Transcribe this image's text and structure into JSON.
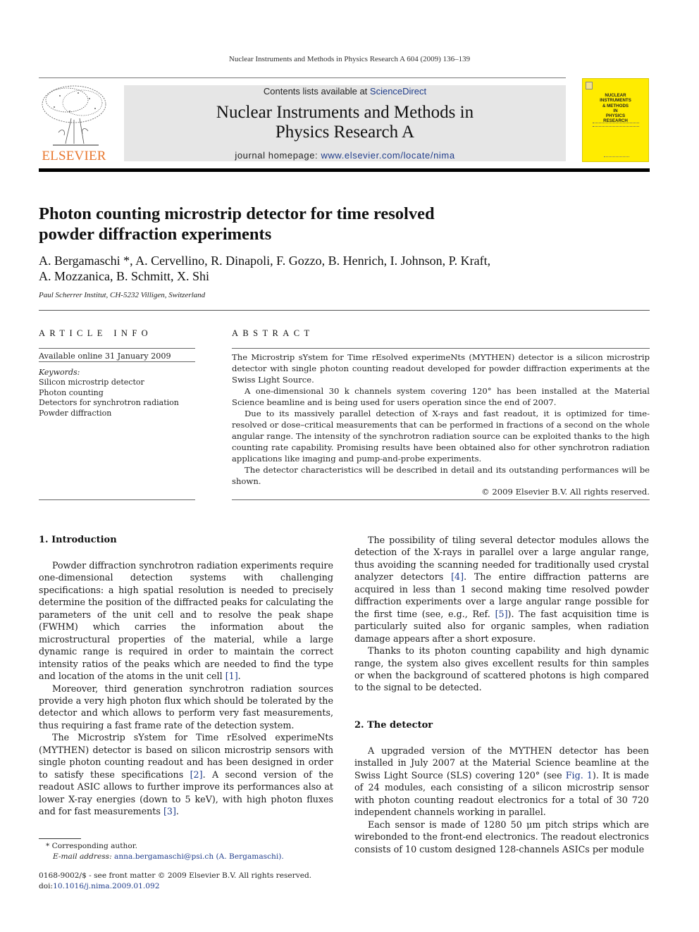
{
  "running_head": "Nuclear Instruments and Methods in Physics Research A 604 (2009) 136–139",
  "masthead": {
    "publisher_logo_text": "ELSEVIER",
    "contents_prefix": "Contents lists available at ",
    "contents_link": "ScienceDirect",
    "journal_title_line1": "Nuclear Instruments and Methods in",
    "journal_title_line2": "Physics Research A",
    "homepage_prefix": "journal homepage: ",
    "homepage_link": "www.elsevier.com/locate/nima",
    "cover_title": [
      "NUCLEAR",
      "INSTRUMENTS",
      "& METHODS",
      "IN",
      "PHYSICS",
      "RESEARCH"
    ],
    "colors": {
      "publisher_orange": "#e8772e",
      "cover_yellow": "#ffec00",
      "link_blue": "#1f3c8a",
      "masthead_gray": "#e6e6e6"
    }
  },
  "article": {
    "title_line1": "Photon counting microstrip detector for time resolved",
    "title_line2": "powder diffraction experiments",
    "authors_line1": "A. Bergamaschi *, A. Cervellino, R. Dinapoli, F. Gozzo, B. Henrich, I. Johnson, P. Kraft,",
    "authors_line2": "A. Mozzanica, B. Schmitt, X. Shi",
    "affiliation": "Paul Scherrer Institut, CH-5232 Villigen, Switzerland"
  },
  "article_info": {
    "heading": "ARTICLE INFO",
    "available_online": "Available online 31 January 2009",
    "keywords_label": "Keywords:",
    "keywords": [
      "Silicon microstrip detector",
      "Photon counting",
      "Detectors for synchrotron radiation",
      "Powder diffraction"
    ]
  },
  "abstract": {
    "heading": "ABSTRACT",
    "paragraphs": [
      "The Microstrip sYstem for Time rEsolved experimeNts (MYTHEN) detector is a silicon microstrip detector with single photon counting readout developed for powder diffraction experiments at the Swiss Light Source.",
      "A one-dimensional 30 k channels system covering 120° has been installed at the Material Science beamline and is being used for users operation since the end of 2007.",
      "Due to its massively parallel detection of X-rays and fast readout, it is optimized for time-resolved or dose–critical measurements that can be performed in fractions of a second on the whole angular range. The intensity of the synchrotron radiation source can be exploited thanks to the high counting rate capability. Promising results have been obtained also for other synchrotron radiation applications like imaging and pump-and-probe experiments.",
      "The detector characteristics will be described in detail and its outstanding performances will be shown."
    ],
    "copyright": "© 2009 Elsevier B.V. All rights reserved."
  },
  "body": {
    "section1_heading": "1.  Introduction",
    "s1_p1_text": "Powder diffraction synchrotron radiation experiments require one-dimensional detection systems with challenging specifications: a high spatial resolution is needed to precisely determine the position of the diffracted peaks for calculating the parameters of the unit cell and to resolve the peak shape (FWHM) which carries the information about the microstructural properties of the material, while a large dynamic range is required in order to maintain the correct intensity ratios of the peaks which are needed to find the type and location of the atoms in the unit cell ",
    "s1_p1_ref": "[1]",
    "s1_p2_text": "Moreover, third generation synchrotron radiation sources provide a very high photon flux which should be tolerated by the detector and which allows to perform very fast measurements, thus requiring a fast frame rate of the detection system.",
    "s1_p3_a": "The Microstrip sYstem for Time rEsolved experimeNts (MYTHEN) detector is based on silicon microstrip sensors with single photon counting readout and has been designed in order to satisfy these specifications ",
    "s1_p3_ref1": "[2]",
    "s1_p3_b": ". A second version of the readout ASIC allows to further improve its performances also at lower X-ray energies (down to 5 keV), with high photon fluxes and for fast measurements ",
    "s1_p3_ref2": "[3]",
    "s1_p4_a": "The possibility of tiling several detector modules allows the detection of the X-rays in parallel over a large angular range, thus avoiding the scanning needed for traditionally used crystal analyzer detectors ",
    "s1_p4_ref1": "[4]",
    "s1_p4_b": ". The entire diffraction patterns are acquired in less than 1 second making time resolved powder diffraction experiments over a large angular range possible for the first time (see, e.g., Ref. ",
    "s1_p4_ref2": "[5]",
    "s1_p4_c": "). The fast acquisition time is particularly suited also for organic samples, when radiation damage appears after a short exposure.",
    "s1_p5_text": "Thanks to its photon counting capability and high dynamic range, the system also gives excellent results for thin samples or when the background of scattered photons is high compared to the signal to be detected.",
    "section2_heading": "2.  The detector",
    "s2_p1_a": "A upgraded version of the MYTHEN detector has been installed in July 2007 at the Material Science beamline at the Swiss Light Source (SLS) covering 120° (see ",
    "s2_p1_ref": "Fig. 1",
    "s2_p1_b": "). It is made of 24 modules, each consisting of a silicon microstrip sensor with photon counting readout electronics for a total of 30 720 independent channels working in parallel.",
    "s2_p2_text": "Each sensor is made of 1280 50 μm pitch strips which are wirebonded to the front-end electronics. The readout electronics consists of 10 custom designed 128-channels ASICs per module"
  },
  "footnotes": {
    "corresponding": "* Corresponding author.",
    "email_label": "E-mail address: ",
    "email_link": "anna.bergamaschi@psi.ch (A. Bergamaschi).",
    "front_matter": "0168-9002/$ - see front matter © 2009 Elsevier B.V. All rights reserved.",
    "doi_prefix": "doi:",
    "doi_link": "10.1016/j.nima.2009.01.092"
  }
}
